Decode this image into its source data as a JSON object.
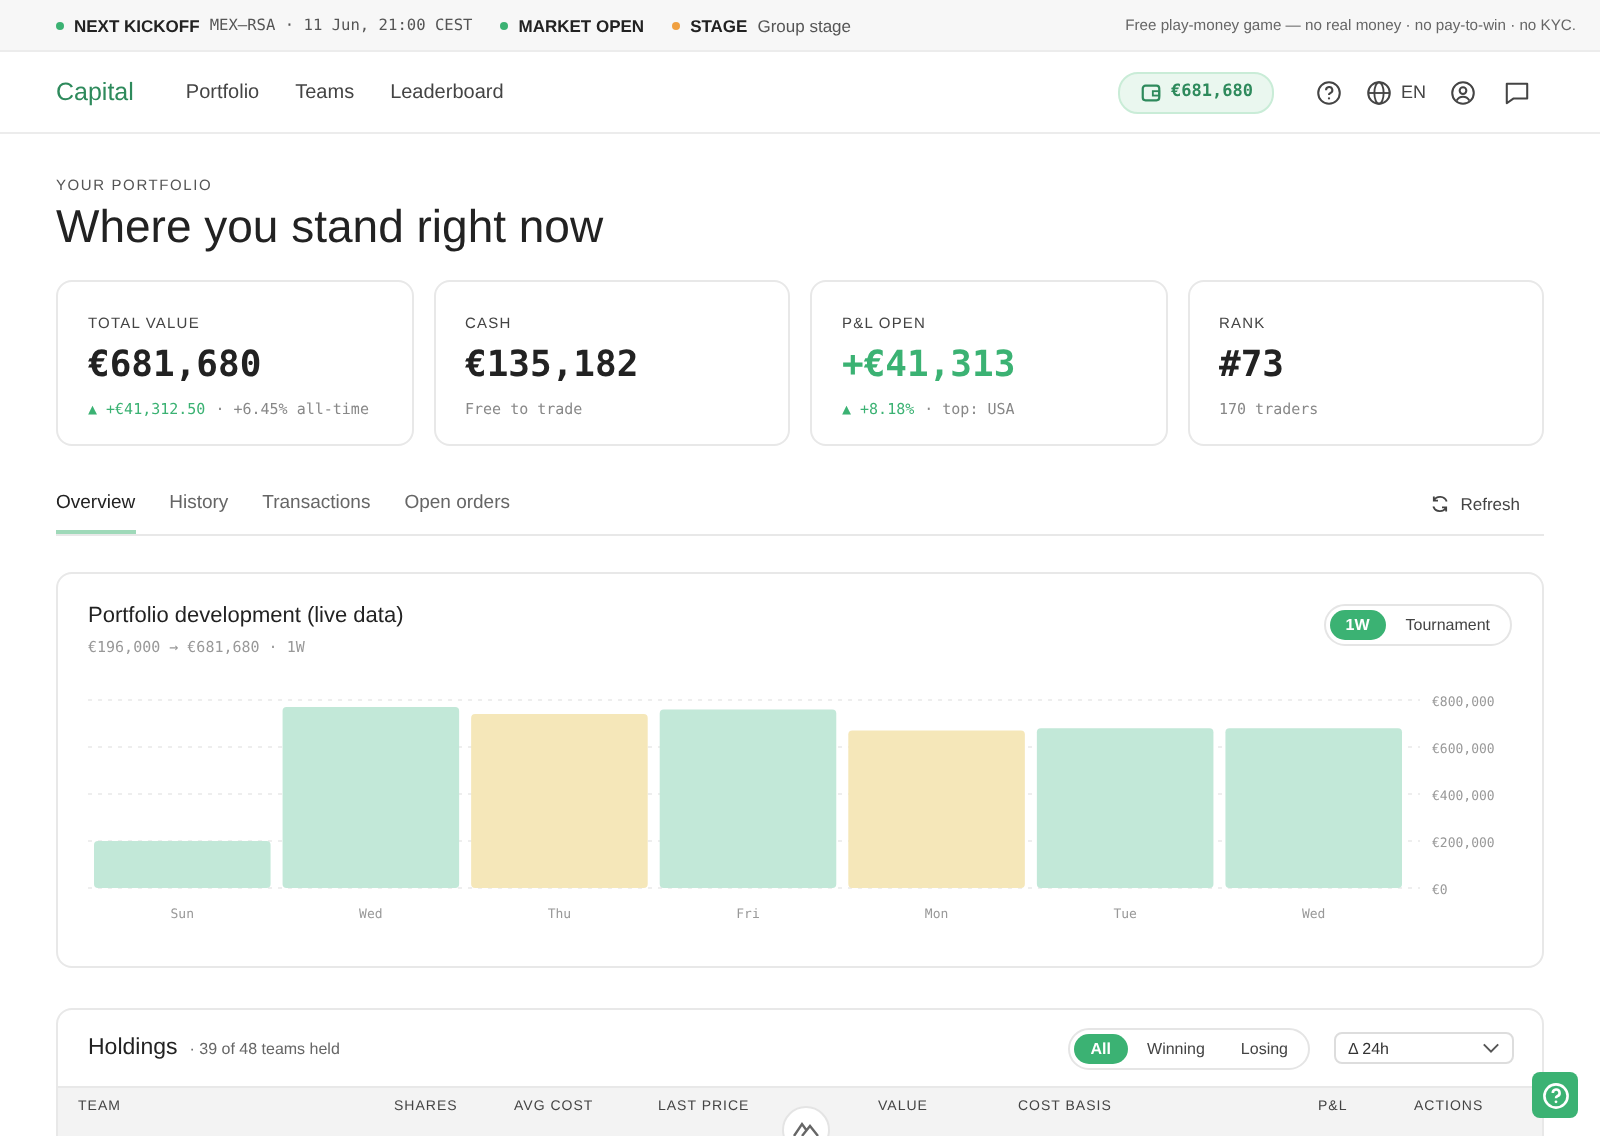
{
  "ticker": [
    {
      "kind": "fixture",
      "label": "NEXT KICKOFF",
      "value": "MEX–RSA · 11 Jun, 21:00 CEST",
      "color": "#3bb273"
    },
    {
      "label": "MARKET OPEN",
      "color": "#3bb273"
    },
    {
      "kind": "stage",
      "label": "STAGE",
      "value": "Group stage",
      "color": "#f0a040"
    }
  ],
  "disclaimer": "Free play-money game — no real money · no pay-to-win · no KYC.",
  "nav": {
    "logo": "Capital",
    "links": [
      "Portfolio",
      "Teams",
      "Leaderboard"
    ],
    "balance": "€681,680",
    "language": "EN"
  },
  "header": {
    "eyebrow": "YOUR PORTFOLIO",
    "title": "Where you stand right now"
  },
  "stats": [
    {
      "label": "TOTAL VALUE",
      "value": "€681,680",
      "positive": false,
      "note_up": "▲ +€41,312.50",
      "note": "· +6.45% all-time"
    },
    {
      "label": "CASH",
      "value": "€135,182",
      "positive": false,
      "note": "Free to trade"
    },
    {
      "label": "P&L OPEN",
      "value": "+€41,313",
      "positive": true,
      "note_up": "▲ +8.18%",
      "note": "· top: USA"
    },
    {
      "label": "RANK",
      "value": "#73",
      "positive": false,
      "note": "170 traders"
    }
  ],
  "tabs": [
    {
      "label": "Overview",
      "selected": true
    },
    {
      "label": "History",
      "selected": false
    },
    {
      "label": "Transactions",
      "selected": false
    },
    {
      "label": "Open orders",
      "selected": false
    }
  ],
  "refresh": "Refresh",
  "chart_card": {
    "title": "Portfolio development (live data)",
    "subtitle": "€196,000 → €681,680 · 1W",
    "ranges": [
      {
        "label": "1W",
        "selected": true
      },
      {
        "label": "Tournament",
        "selected": false
      }
    ],
    "chart_data": {
      "type": "bar",
      "grid": true,
      "categories": [
        "Sun",
        "Wed",
        "Thu",
        "Fri",
        "Mon",
        "Tue",
        "Wed"
      ],
      "values": [
        200000,
        770000,
        740000,
        760000,
        670000,
        680000,
        680000
      ],
      "ylim": [
        0,
        800000
      ],
      "yticks": [
        {
          "value": 0,
          "label": "€0"
        },
        {
          "value": 200000,
          "label": "€200,000"
        },
        {
          "value": 400000,
          "label": "€400,000"
        },
        {
          "value": 600000,
          "label": "€600,000"
        },
        {
          "value": 800000,
          "label": "€800,000"
        }
      ]
    }
  },
  "holdings": {
    "title": "Holdings",
    "count": "· 39 of 48 teams held",
    "filters": [
      {
        "label": "All",
        "selected": true
      },
      {
        "label": "Winning",
        "selected": false
      },
      {
        "label": "Losing",
        "selected": false
      }
    ],
    "sort": "Δ 24h",
    "columns": [
      "TEAM",
      "SHARES",
      "AVG COST",
      "LAST PRICE",
      "VALUE",
      "COST BASIS",
      "P&L",
      "ACTIONS"
    ]
  }
}
